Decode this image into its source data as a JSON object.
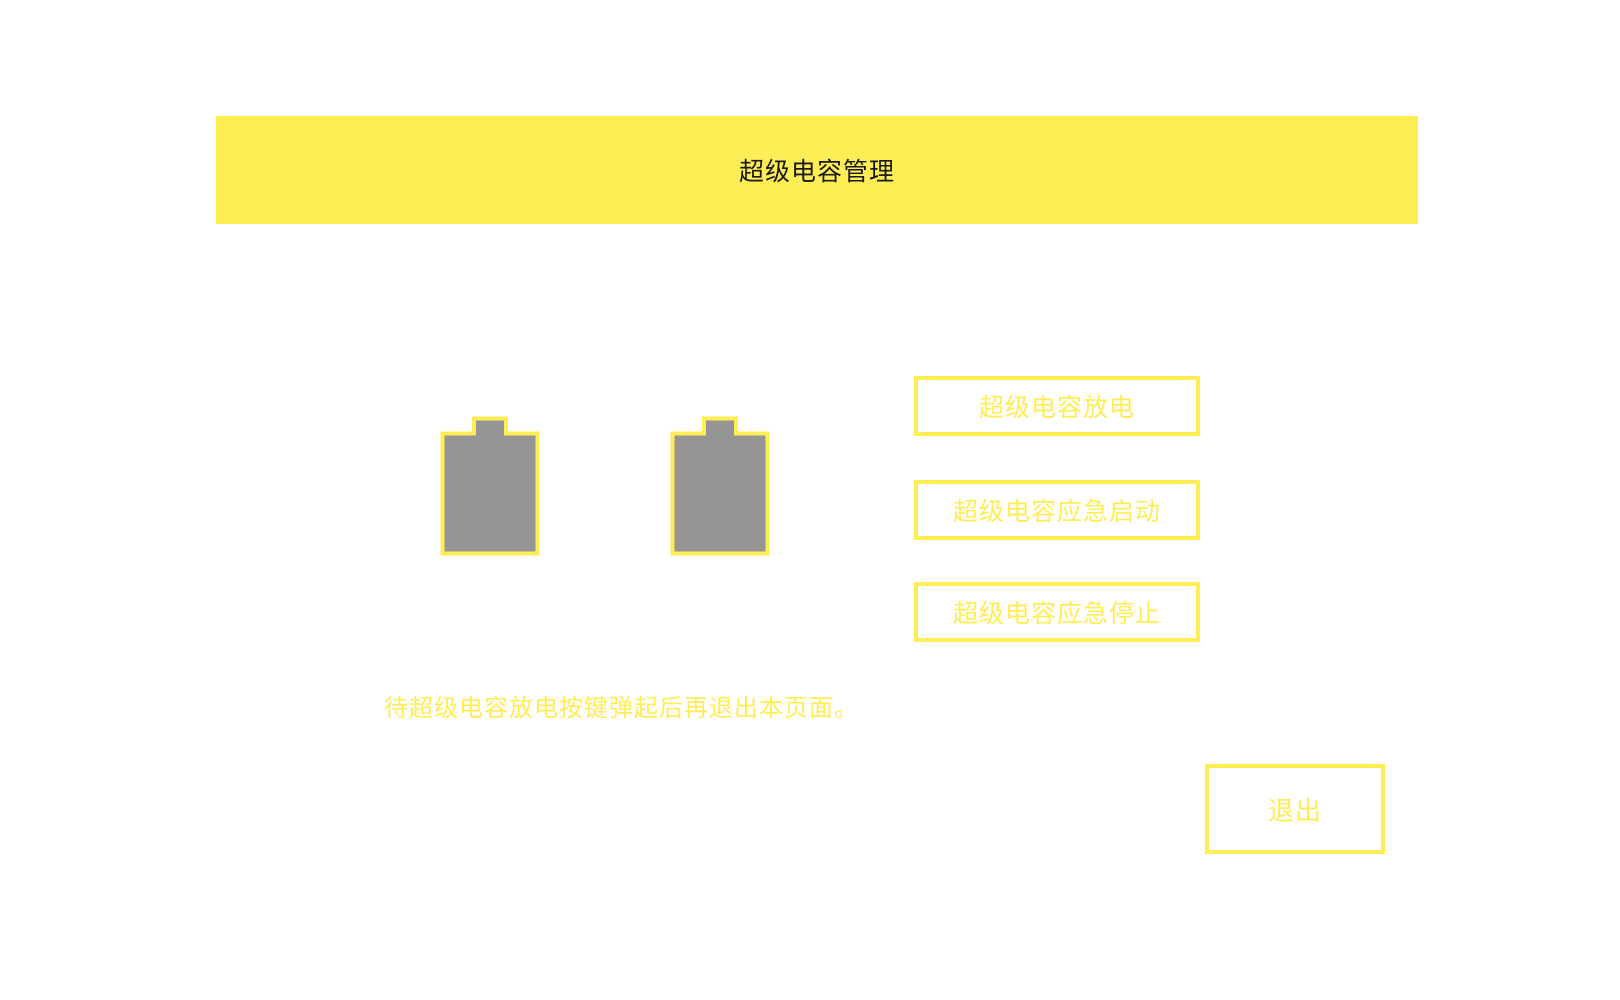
{
  "header": {
    "title": "超级电容管理"
  },
  "capacitors": [
    {
      "name": "capacitor-1",
      "icon": "battery-icon"
    },
    {
      "name": "capacitor-2",
      "icon": "battery-icon"
    }
  ],
  "actions": {
    "discharge_label": "超级电容放电",
    "emergency_start_label": "超级电容应急启动",
    "emergency_stop_label": "超级电容应急停止"
  },
  "hint_text": "待超级电容放电按键弹起后再退出本页面。",
  "exit_label": "退出",
  "colors": {
    "accent": "#ffed55",
    "battery_fill": "#959595",
    "background": "#ffffff",
    "title_text": "#1a1a1a"
  }
}
